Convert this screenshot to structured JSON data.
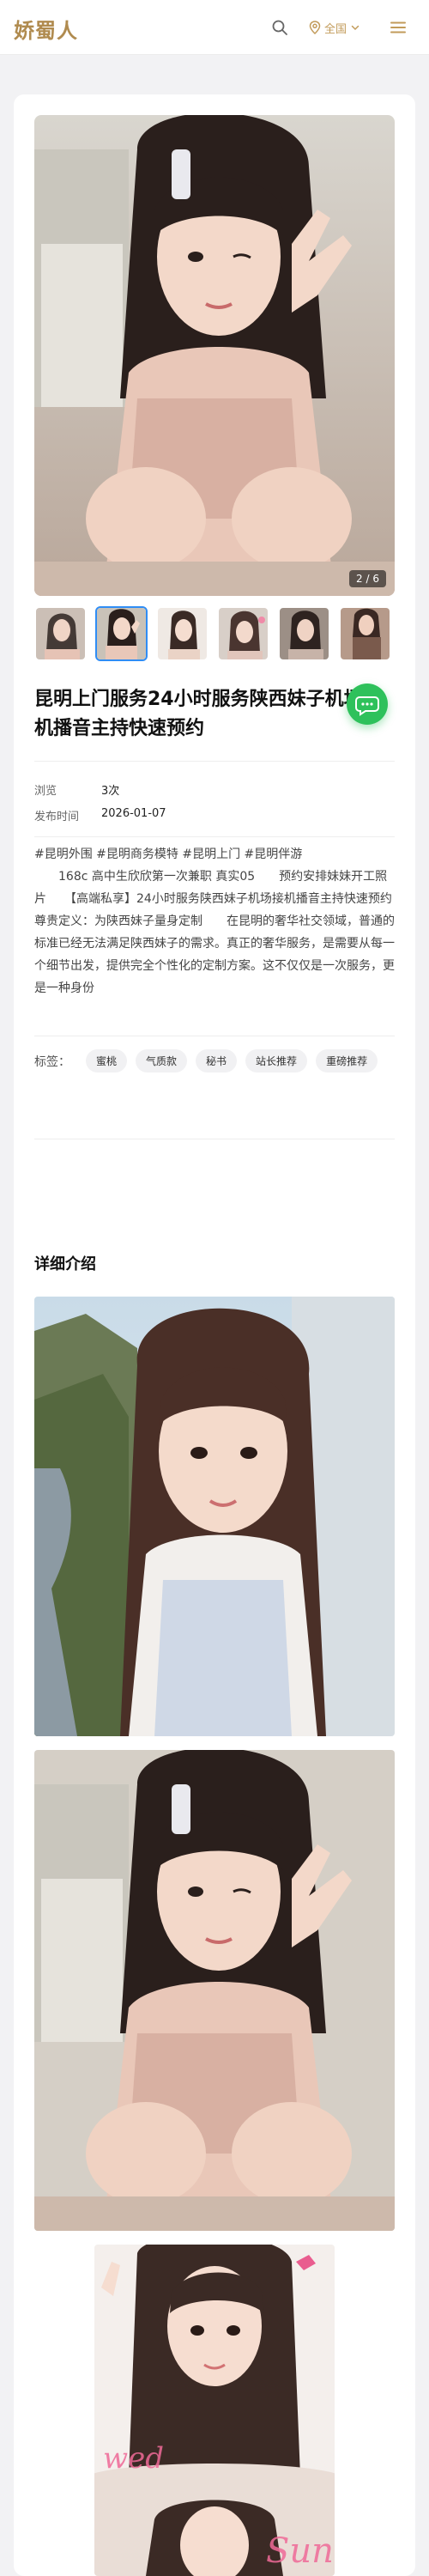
{
  "header": {
    "logo": "娇蜀人",
    "region_label": "全国",
    "search_icon": "search-icon",
    "location_icon": "location-pin-icon",
    "menu_icon": "hamburger-menu-icon"
  },
  "gallery": {
    "counter": "2 / 6",
    "active_index": 1,
    "thumb_count": 6
  },
  "listing": {
    "title": "昆明上门服务24小时服务陕西妹子机场接机播音主持快速预约",
    "meta": {
      "views_label": "浏览",
      "views_value": "3次",
      "date_label": "发布时间",
      "date_value": "2026-01-07"
    },
    "description": "#昆明外围 #昆明商务模特 #昆明上门 #昆明伴游\n　　168c 高中生欣欣第一次兼职 真实05　　预约安排妹妹开工照片　　【高端私享】24小时服务陕西妹子机场接机播音主持快速预约　　尊贵定义：为陕西妹子量身定制　　在昆明的奢华社交领域，普通的标准已经无法满足陕西妹子的需求。真正的奢华服务，是需要从每一个细节出发，提供完全个性化的定制方案。这不仅仅是一次服务，更是一种身份",
    "tags_label": "标签：",
    "tags": [
      "蜜桃",
      "气质款",
      "秘书",
      "站长推荐",
      "重磅推荐"
    ]
  },
  "detail": {
    "section_title": "详细介绍"
  },
  "colors": {
    "brand": "#b08b4f",
    "region": "#c29b5a",
    "active_thumb": "#2f8df5",
    "chat_button": "#2ec15b"
  },
  "chat_icon": "chat-bubble-icon"
}
